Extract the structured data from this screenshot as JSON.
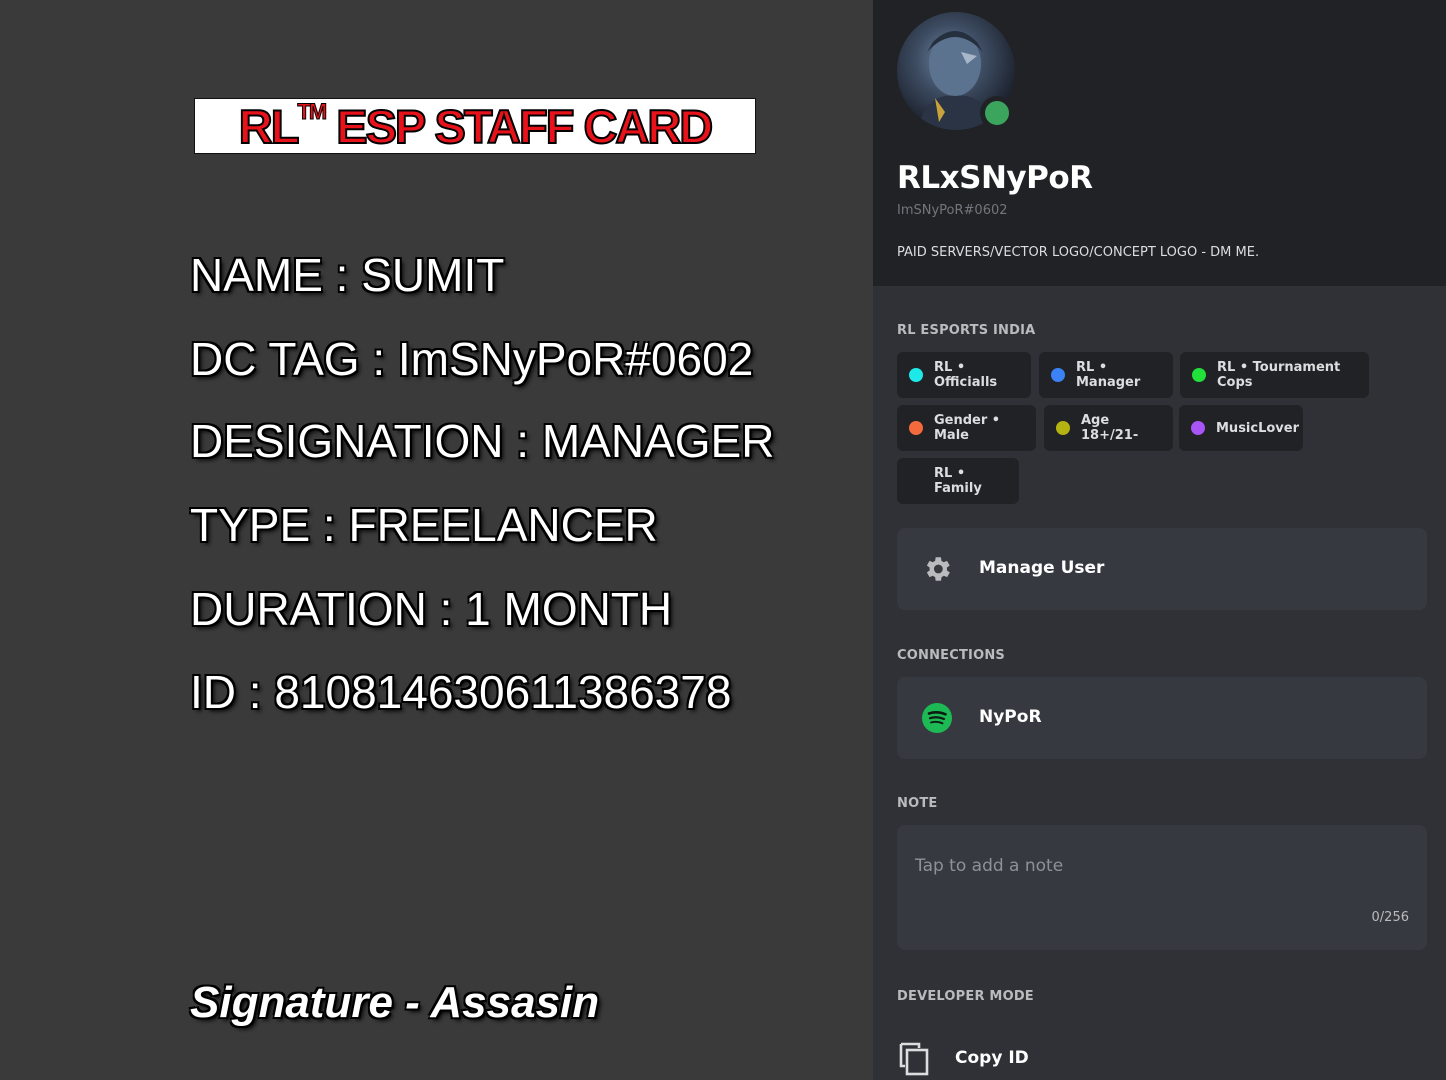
{
  "card": {
    "title_main": "RL",
    "title_tm": "TM",
    "title_rest": " ESP STAFF CARD",
    "fields": [
      "NAME : SUMIT",
      "DC TAG : ImSNyPoR#0602",
      "DESIGNATION : MANAGER",
      "TYPE : FREELANCER",
      "DURATION : 1 MONTH",
      "ID : 810814630611386378"
    ],
    "signature": "Signature - Assasin"
  },
  "profile": {
    "display_name": "RLxSNyPoR",
    "user_tag": "ImSNyPoR#0602",
    "bio": "PAID SERVERS/VECTOR LOGO/CONCEPT LOGO - DM ME.",
    "status_color": "#3ba55d"
  },
  "roles_section": {
    "label": "RL ESPORTS INDIA",
    "roles": [
      {
        "label": "RL • Officialls",
        "color": "#1de9e9"
      },
      {
        "label": "RL • Manager",
        "color": "#3b82f6"
      },
      {
        "label": "RL • Tournament Cops",
        "color": "#22e03a"
      },
      {
        "label": "Gender • Male",
        "color": "#f46a3c"
      },
      {
        "label": "Age 18+/21-",
        "color": "#b5b312"
      },
      {
        "label": "MusicLover",
        "color": "#a855f7"
      },
      {
        "label": "RL • Family",
        "color": ""
      }
    ]
  },
  "manage_user": {
    "label": "Manage User",
    "icon": "gear-icon"
  },
  "connections": {
    "label": "CONNECTIONS",
    "items": [
      {
        "label": "NyPoR",
        "icon": "spotify-icon",
        "color": "#1db954"
      }
    ]
  },
  "note": {
    "label": "NOTE",
    "placeholder": "Tap to add a note",
    "counter": "0/256"
  },
  "developer": {
    "label": "DEVELOPER MODE",
    "copy_id": "Copy ID",
    "icon": "copy-icon"
  }
}
